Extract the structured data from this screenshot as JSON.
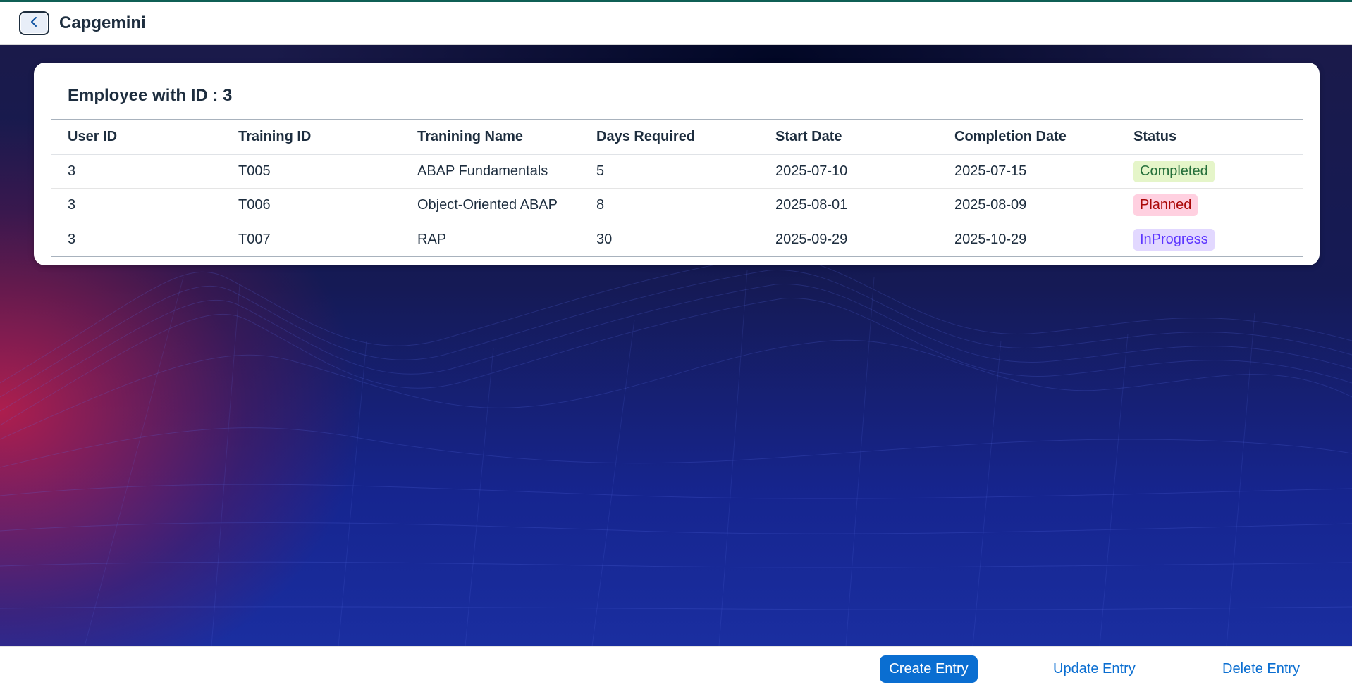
{
  "header": {
    "app_title": "Capgemini",
    "back_icon": "chevron-left-icon"
  },
  "card": {
    "title": "Employee with ID : 3",
    "columns": [
      "User ID",
      "Training ID",
      "Tranining Name",
      "Days Required",
      "Start Date",
      "Completion Date",
      "Status"
    ],
    "rows": [
      {
        "user_id": "3",
        "training_id": "T005",
        "training_name": "ABAP Fundamentals",
        "days": "5",
        "start": "2025-07-10",
        "end": "2025-07-15",
        "status": "Completed"
      },
      {
        "user_id": "3",
        "training_id": "T006",
        "training_name": "Object-Oriented ABAP",
        "days": "8",
        "start": "2025-08-01",
        "end": "2025-08-09",
        "status": "Planned"
      },
      {
        "user_id": "3",
        "training_id": "T007",
        "training_name": "RAP",
        "days": "30",
        "start": "2025-09-29",
        "end": "2025-10-29",
        "status": "InProgress"
      }
    ]
  },
  "status_colors": {
    "Completed": {
      "bg": "#e5f5c9",
      "fg": "#256f3a"
    },
    "Planned": {
      "bg": "#ffd0e0",
      "fg": "#aa0808"
    },
    "InProgress": {
      "bg": "#e2d8ff",
      "fg": "#5d36ff"
    }
  },
  "footer": {
    "create_label": "Create Entry",
    "update_label": "Update Entry",
    "delete_label": "Delete Entry"
  },
  "colors": {
    "accent": "#0a6ed1",
    "text": "#1d2d3e",
    "topline": "#0f5f55"
  }
}
